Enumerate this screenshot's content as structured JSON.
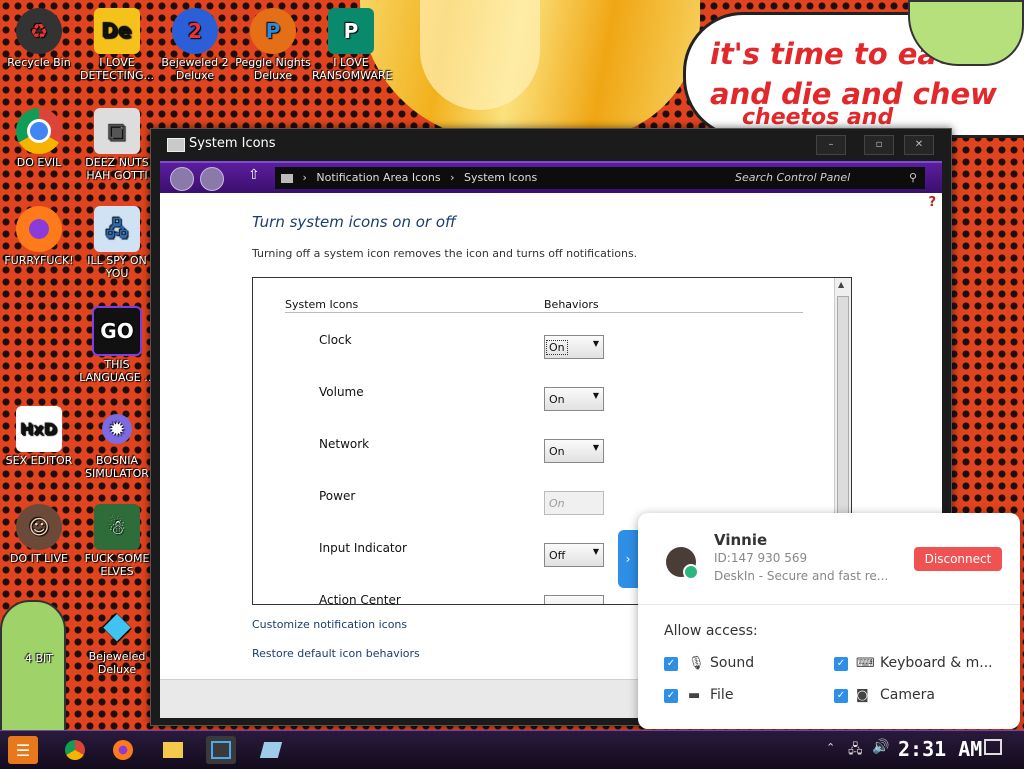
{
  "desktop": {
    "icons": [
      {
        "label": "Recycle Bin",
        "icon": "recycle-bin-icon"
      },
      {
        "label": "I LOVE DETECTING...",
        "icon": "detect-it-easy-icon"
      },
      {
        "label": "Bejeweled 2 Deluxe",
        "icon": "bejeweled-2-icon"
      },
      {
        "label": "Peggle Nights Deluxe",
        "icon": "peggle-icon"
      },
      {
        "label": "I LOVE RANSOMWARE",
        "icon": "publisher-icon"
      },
      {
        "label": "DO EVIL",
        "icon": "chrome-icon"
      },
      {
        "label": "DEEZ NUTS HAH GOTTI",
        "icon": "windows-stack-icon"
      },
      {
        "label": "FURRYFUCK!",
        "icon": "firefox-icon"
      },
      {
        "label": "ILL SPY ON YOU",
        "icon": "network-spy-icon"
      },
      {
        "label": "THIS LANGUAGE ...",
        "icon": "goland-icon"
      },
      {
        "label": "SEX EDITOR",
        "icon": "hxd-icon"
      },
      {
        "label": "BOSNIA SIMULATOR",
        "icon": "mine-icon"
      },
      {
        "label": "DO IT LIVE",
        "icon": "portrait-icon"
      },
      {
        "label": "FUCK SOME ELVES",
        "icon": "elf-icon"
      },
      {
        "label": "4 BIT",
        "icon": "character-icon"
      },
      {
        "label": "Bejeweled Deluxe",
        "icon": "diamond-icon"
      }
    ],
    "bubble": {
      "line1": "it's time to eat sh",
      "line2": "and die and chew",
      "line3": "cheetos and"
    }
  },
  "window": {
    "title": "System Icons",
    "min": "–",
    "max": "▫",
    "close": "✕",
    "breadcrumb": [
      "Notification Area Icons",
      "System Icons"
    ],
    "search_placeholder": "Search Control Panel",
    "help": "?",
    "heading": "Turn system icons on or off",
    "description": "Turning off a system icon removes the icon and turns off notifications.",
    "columns": {
      "icons": "System Icons",
      "behaviors": "Behaviors"
    },
    "rows": [
      {
        "name": "Clock",
        "value": "On",
        "disabled": false
      },
      {
        "name": "Volume",
        "value": "On",
        "disabled": false
      },
      {
        "name": "Network",
        "value": "On",
        "disabled": false
      },
      {
        "name": "Power",
        "value": "On",
        "disabled": true
      },
      {
        "name": "Input Indicator",
        "value": "Off",
        "disabled": false
      },
      {
        "name": "Action Center",
        "value": "",
        "disabled": false
      }
    ],
    "links": {
      "customize": "Customize notification icons",
      "restore": "Restore default icon behaviors"
    }
  },
  "remote": {
    "tab_arrow": "›",
    "name": "Vinnie",
    "id": "ID:147 930 569",
    "app": "DeskIn - Secure and fast re...",
    "disconnect": "Disconnect",
    "allow_access": "Allow access:",
    "permissions": [
      {
        "label": "Sound",
        "icon": "microphone-icon",
        "checked": true
      },
      {
        "label": "Keyboard & m...",
        "icon": "keyboard-icon",
        "checked": true
      },
      {
        "label": "File",
        "icon": "folder-icon",
        "checked": true
      },
      {
        "label": "Camera",
        "icon": "camera-icon",
        "checked": true
      }
    ],
    "accent": "#2f8ee6",
    "disconnect_color": "#f05252"
  },
  "taskbar": {
    "clock": "2:31 AM",
    "apps": [
      "start-icon",
      "chrome-icon",
      "firefox-icon",
      "file-explorer-icon",
      "remote-desktop-icon",
      "notes-icon"
    ]
  }
}
